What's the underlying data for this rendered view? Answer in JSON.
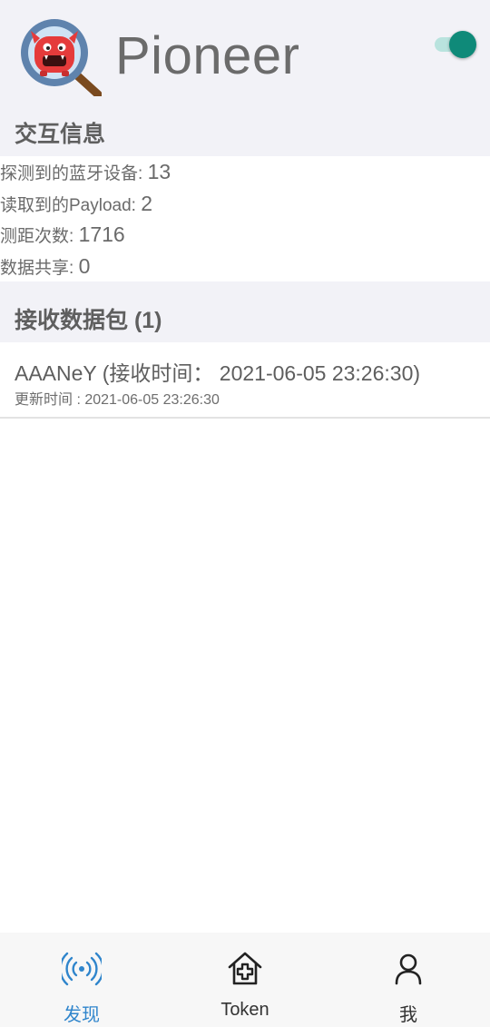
{
  "app": {
    "title": "Pioneer",
    "toggle_on": true
  },
  "sections": {
    "interaction": "交互信息",
    "packets": "接收数据包 (1)"
  },
  "info": [
    {
      "label": "探测到的蓝牙设备: ",
      "value": "13"
    },
    {
      "label": "读取到的Payload: ",
      "value": "2"
    },
    {
      "label": "测距次数: ",
      "value": "1716"
    },
    {
      "label": "数据共享: ",
      "value": "0"
    }
  ],
  "packets": [
    {
      "title": "AAANeY (接收时间： 2021-06-05 23:26:30)",
      "updated": "更新时间 : 2021-06-05 23:26:30"
    }
  ],
  "tabs": [
    {
      "label": "发现",
      "icon": "broadcast-icon",
      "active": true
    },
    {
      "label": "Token",
      "icon": "medical-home-icon",
      "active": false
    },
    {
      "label": "我",
      "icon": "person-icon",
      "active": false
    }
  ],
  "colors": {
    "accent": "#2f85cc",
    "toggle_knob": "#0f8a79",
    "toggle_track": "#b9e3de",
    "section_bg": "#f2f2f7"
  }
}
